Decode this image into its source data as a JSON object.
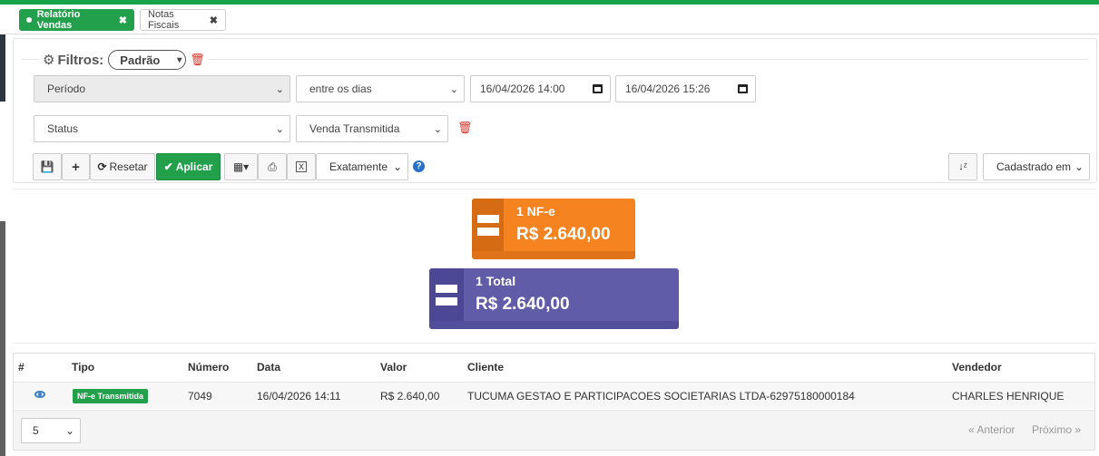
{
  "tabs": [
    {
      "label": "Relatório Vendas",
      "close": "✖"
    },
    {
      "label": "Notas Fiscais",
      "close": "✖"
    }
  ],
  "filters": {
    "title": "Filtros:",
    "preset": "Padrão",
    "field1": "Período",
    "op1": "entre os dias",
    "date_from": "16/04/2026 14:00",
    "date_to": "16/04/2026 15:26",
    "field2": "Status",
    "value2": "Venda Transmitida"
  },
  "toolbar": {
    "reset_label": "Resetar",
    "apply_label": "Aplicar",
    "match_mode": "Exatamente",
    "sort_field": "Cadastrado em"
  },
  "stats": [
    {
      "title": "1 NF-e",
      "value": "R$ 2.640,00",
      "color": "#f48320"
    },
    {
      "title": "1 Total",
      "value": "R$ 2.640,00",
      "color": "#605ca8"
    }
  ],
  "table": {
    "headers": [
      "#",
      "Tipo",
      "Número",
      "Data",
      "Valor",
      "Cliente",
      "Vendedor"
    ],
    "rows": [
      {
        "tipo": "NF-e Transmitida",
        "numero": "7049",
        "data": "16/04/2026 14:11",
        "valor": "R$ 2.640,00",
        "cliente": "TUCUMA GESTAO E PARTICIPACOES SOCIETARIAS LTDA-62975180000184",
        "vendedor": "CHARLES HENRIQUE"
      }
    ]
  },
  "pagination": {
    "page_size": "5",
    "prev": "« Anterior",
    "next": "Próximo »"
  },
  "icons": {
    "tab_dot": "dot-icon",
    "settings": "gear-icon",
    "delete": "trash-icon",
    "save": "save-icon",
    "add": "plus-icon",
    "refresh": "refresh-icon",
    "check": "check-icon",
    "columns": "table-icon",
    "print": "print-icon",
    "excel": "excel-icon",
    "help": "question-icon",
    "sort": "sort-icon",
    "view": "eye-icon",
    "stat": "equals-icon"
  }
}
